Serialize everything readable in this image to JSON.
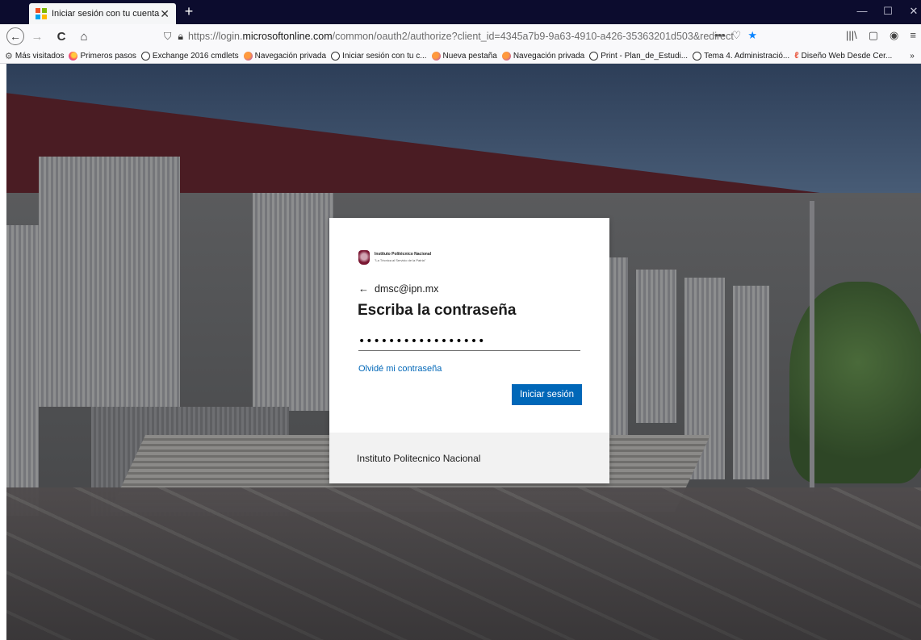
{
  "browser": {
    "tab": {
      "title": "Iniciar sesión con tu cuenta",
      "close": "✕"
    },
    "new_tab": "+",
    "window": {
      "minimize": "—",
      "maximize": "☐",
      "close": "✕"
    },
    "nav": {
      "back": "←",
      "forward": "→",
      "reload": "C",
      "home": "⌂"
    },
    "url": {
      "prefix": "https://login.",
      "domain": "microsoftonline.com",
      "path": "/common/oauth2/authorize?client_id=4345a7b9-9a63-4910-a426-35363201d503&redirect"
    },
    "url_icons": {
      "more": "•••",
      "pocket": "♡",
      "bookmark": "★"
    },
    "right_icons": {
      "library": "|||\\",
      "sidebar": "▢",
      "account": "◉",
      "menu": "≡"
    },
    "bookmarks": [
      {
        "label": "Más visitados",
        "icon": "gear-icon"
      },
      {
        "label": "Primeros pasos",
        "icon": "firefox-icon"
      },
      {
        "label": "Exchange 2016 cmdlets",
        "icon": "globe-icon"
      },
      {
        "label": "Navegación privada",
        "icon": "private-icon"
      },
      {
        "label": "Iniciar sesión con tu c...",
        "icon": "globe-icon"
      },
      {
        "label": "Nueva pestaña",
        "icon": "private-icon"
      },
      {
        "label": "Navegación privada",
        "icon": "private-icon"
      },
      {
        "label": "Print - Plan_de_Estudi...",
        "icon": "globe-icon"
      },
      {
        "label": "Tema 4. Administració...",
        "icon": "globe-icon"
      },
      {
        "label": "Diseño Web Desde Cer...",
        "icon": "dw-icon"
      }
    ],
    "bookmarks_overflow": "»"
  },
  "login": {
    "logo": {
      "line1": "Instituto Politécnico Nacional",
      "line2": "\"La Técnica al Servicio de la Patria\""
    },
    "back_arrow": "←",
    "identity": "dmsc@ipn.mx",
    "title": "Escriba la contraseña",
    "password_value": "•••••••••••••••••",
    "forgot_link": "Olvidé mi contraseña",
    "signin_button": "Iniciar sesión",
    "footer": "Instituto Politecnico Nacional"
  },
  "colors": {
    "accent": "#0067b8",
    "tabstrip": "#0c0c2e",
    "footer_bg": "#f2f2f2"
  }
}
